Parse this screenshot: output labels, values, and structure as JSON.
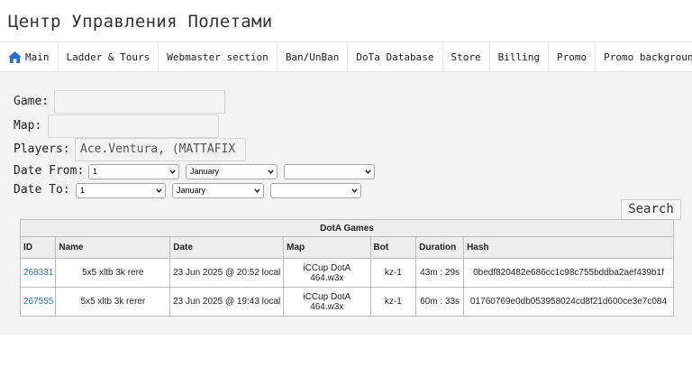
{
  "app": {
    "title": "Центр Управления Полетами"
  },
  "nav": {
    "items": [
      {
        "label": "Main",
        "icon": "home-icon"
      },
      {
        "label": "Ladder & Tours"
      },
      {
        "label": "Webmaster section"
      },
      {
        "label": "Ban/UnBan"
      },
      {
        "label": "DoTa Database"
      },
      {
        "label": "Store"
      },
      {
        "label": "Billing"
      },
      {
        "label": "Promo"
      },
      {
        "label": "Promo background"
      }
    ]
  },
  "form": {
    "game_label": "Game:",
    "game_value": "",
    "map_label": "Map:",
    "map_value": "",
    "players_label": "Players:",
    "players_value": "Ace.Ventura, (MATTAFIX",
    "date_from_label": "Date From:",
    "date_to_label": "Date To:",
    "date_from": {
      "day": "1",
      "month": "January",
      "year": ""
    },
    "date_to": {
      "day": "1",
      "month": "January",
      "year": ""
    },
    "search_label": "Search"
  },
  "table": {
    "caption": "DotA Games",
    "columns": [
      "ID",
      "Name",
      "Date",
      "Map",
      "Bot",
      "Duration",
      "Hash"
    ],
    "rows": [
      {
        "id": "268331",
        "name": "5x5 xltb 3k rere",
        "date": "23 Jun 2025 @ 20:52 local",
        "map_line1": "iCCup DotA",
        "map_line2": "464.w3x",
        "bot": "kz-1",
        "duration": "43m : 29s",
        "hash": "0bedf820482e686cc1c98c755bddba2aef439b1f"
      },
      {
        "id": "267555",
        "name": "5x5 xltb 3k rerer",
        "date": "23 Jun 2025 @ 19:43 local",
        "map_line1": "iCCup DotA",
        "map_line2": "464.w3x",
        "bot": "kz-1",
        "duration": "60m : 33s",
        "hash": "01760769e0db053958024cd8f21d600ce3e7c084"
      }
    ]
  },
  "colors": {
    "link": "#1f6fd1",
    "home_icon": "#2a6fd6"
  }
}
